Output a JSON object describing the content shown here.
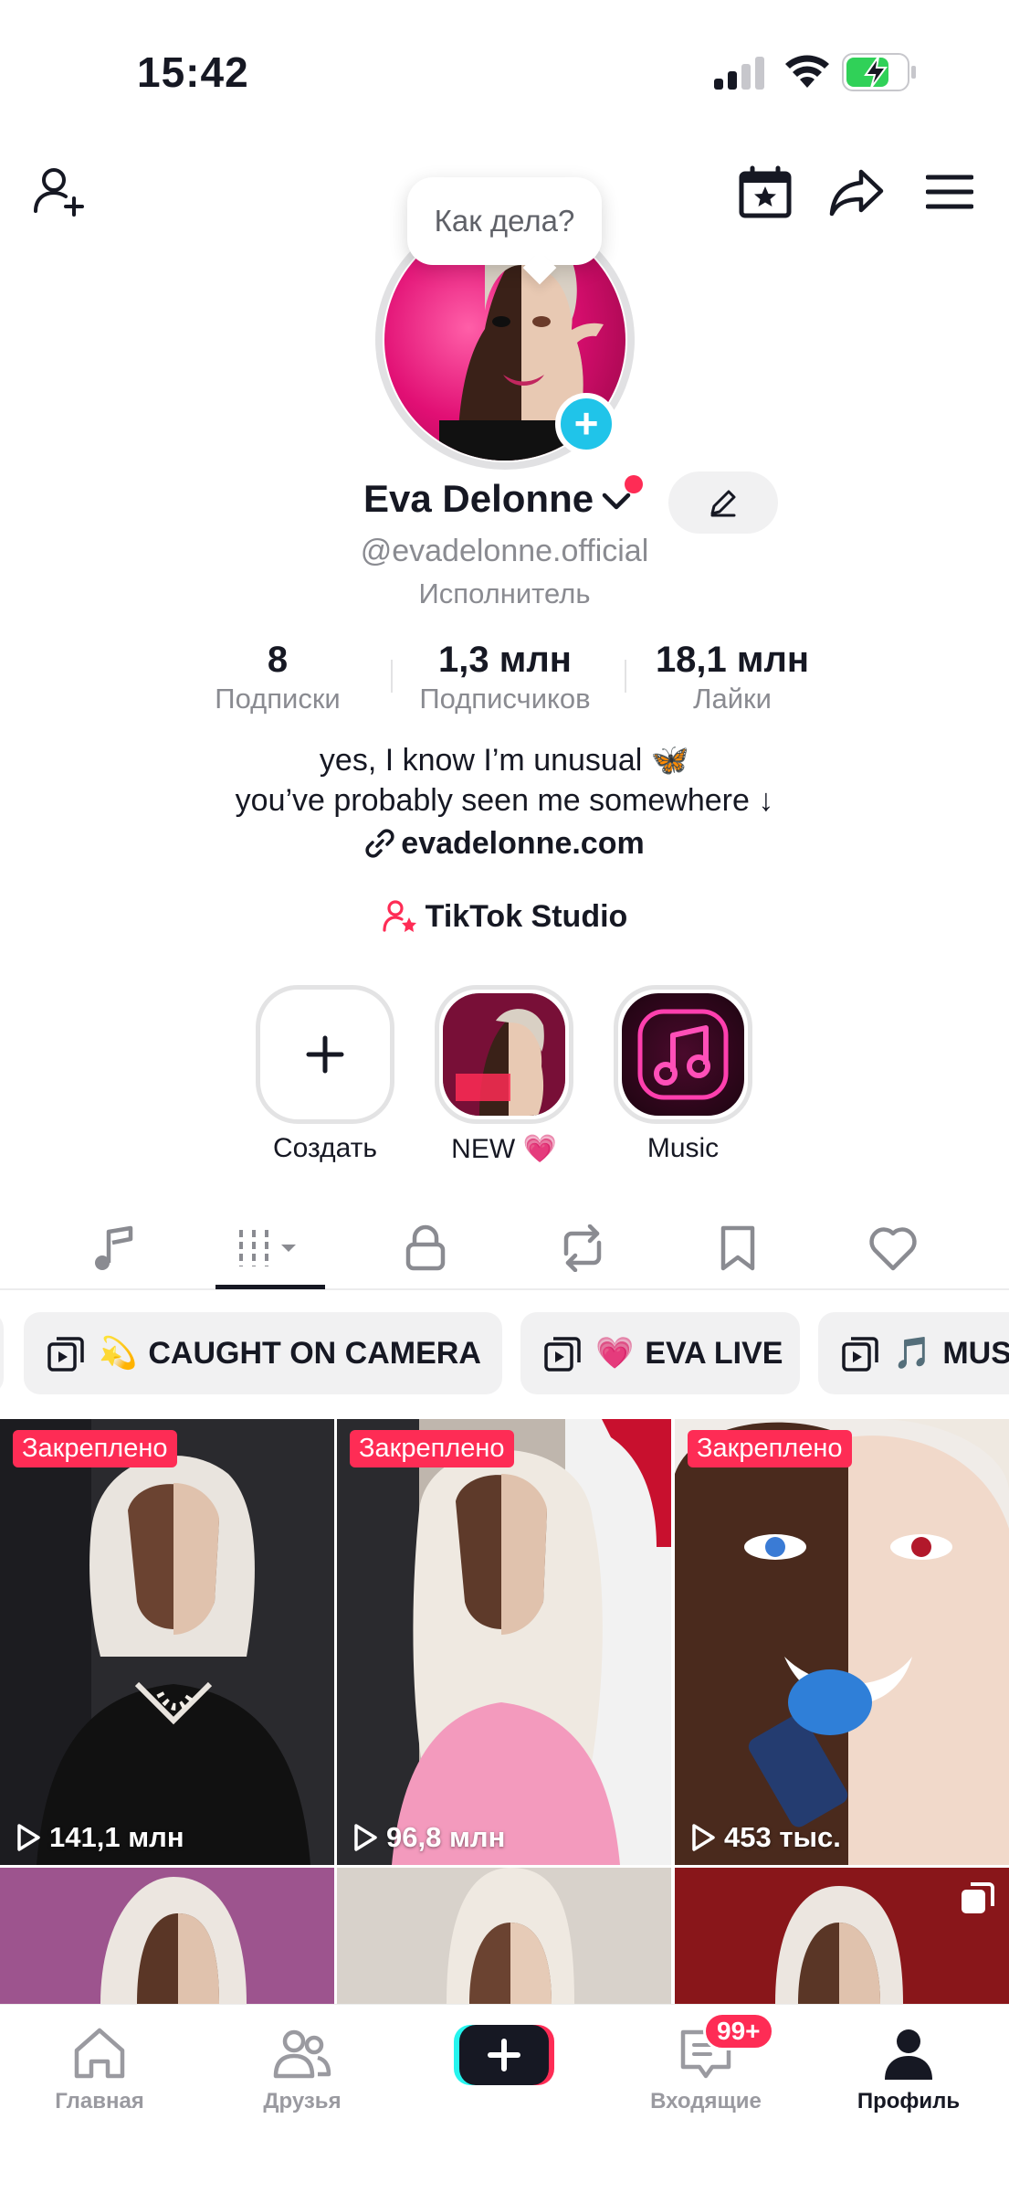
{
  "status_bar": {
    "time": "15:42"
  },
  "profile": {
    "greeting_bubble": "Как дела?",
    "name": "Eva Delonne",
    "username": "@evadelonne.official",
    "category": "Исполнитель",
    "stats": [
      {
        "value": "8",
        "label": "Подписки"
      },
      {
        "value": "1,3 млн",
        "label": "Подписчиков"
      },
      {
        "value": "18,1 млн",
        "label": "Лайки"
      }
    ],
    "bio_line1": "yes, I know I’m unusual 🦋",
    "bio_line2": "you’ve probably seen me somewhere ↓",
    "link": "evadelonne.com",
    "studio": "TikTok Studio"
  },
  "highlights": [
    {
      "label": "Создать",
      "icon": "plus-icon"
    },
    {
      "label": "NEW 💗",
      "icon": "cover-image"
    },
    {
      "label": "Music",
      "icon": "music-note-icon"
    }
  ],
  "tabs": [
    {
      "icon": "music-note-icon"
    },
    {
      "icon": "grid-icon"
    },
    {
      "icon": "lock-icon"
    },
    {
      "icon": "repost-icon"
    },
    {
      "icon": "bookmark-icon"
    },
    {
      "icon": "heart-icon"
    }
  ],
  "playlists": [
    {
      "emoji": "💫",
      "label": "CAUGHT ON CAMERA"
    },
    {
      "emoji": "💗",
      "label": "EVA LIVE"
    },
    {
      "emoji": "🎵",
      "label": "MUS"
    }
  ],
  "videos": [
    {
      "badge": "Закреплено",
      "views": "141,1 млн"
    },
    {
      "badge": "Закреплено",
      "views": "96,8 млн"
    },
    {
      "badge": "Закреплено",
      "views": "453 тыс."
    }
  ],
  "bottom_nav": {
    "home": "Главная",
    "friends": "Друзья",
    "inbox": "Входящие",
    "inbox_badge": "99+",
    "profile": "Профиль"
  },
  "colors": {
    "accent": "#fe2c55",
    "cyan": "#20c4e9",
    "text": "#161823",
    "muted": "#8a8b91"
  }
}
